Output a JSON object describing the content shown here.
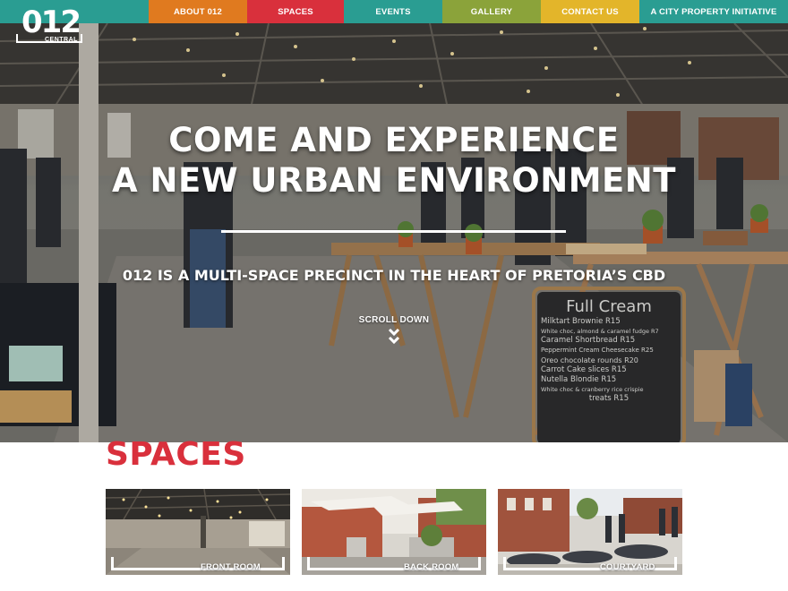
{
  "brand": {
    "logo_number": "012",
    "logo_sub": "CENTRAL"
  },
  "nav": [
    {
      "label": "ABOUT 012",
      "color": "#e07a1f",
      "width": 110
    },
    {
      "label": "SPACES",
      "color": "#d9303c",
      "width": 108
    },
    {
      "label": "EVENTS",
      "color": "#2a9d92",
      "width": 110
    },
    {
      "label": "GALLERY",
      "color": "#8ba33a",
      "width": 110
    },
    {
      "label": "CONTACT US",
      "color": "#e3b52a",
      "width": 110
    },
    {
      "label": "A CITY PROPERTY INITIATIVE",
      "color": "#2a9d92",
      "width": 166
    }
  ],
  "hero": {
    "title_line1": "COME AND EXPERIENCE",
    "title_line2": "A NEW URBAN ENVIRONMENT",
    "subtitle": "012 IS A MULTI-SPACE PRECINCT IN THE HEART OF PRETORIA’S CBD",
    "scroll_label": "SCROLL DOWN",
    "chalkboard": {
      "heading": "Full Cream",
      "lines": [
        "Milktart Brownie R15",
        "White choc, almond & caramel fudge R7",
        "Caramel Shortbread R15",
        "Peppermint Cream Cheesecake R25",
        "Oreo chocolate rounds R20",
        "Carrot Cake slices R15",
        "Nutella Blondie R15",
        "White choc & cranberry rice crispie",
        "treats R15"
      ]
    }
  },
  "spaces": {
    "title": "SPACES",
    "cards": [
      {
        "label": "FRONT ROOM"
      },
      {
        "label": "BACK ROOM"
      },
      {
        "label": "COURTYARD"
      }
    ]
  },
  "colors": {
    "accent_red": "#d9303c",
    "teal": "#2a9d92"
  }
}
